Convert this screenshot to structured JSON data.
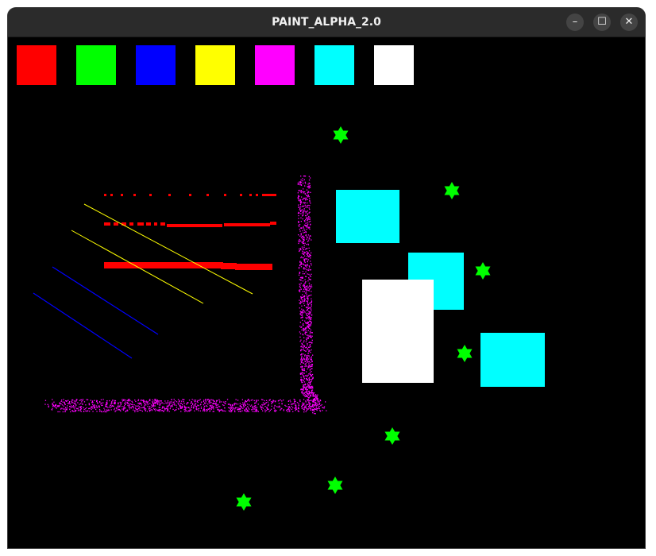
{
  "window": {
    "title": "PAINT_ALPHA_2.0",
    "controls": {
      "minimize": "–",
      "maximize": "☐",
      "close": "✕"
    }
  },
  "palette": [
    {
      "name": "red",
      "color": "#ff0000"
    },
    {
      "name": "green",
      "color": "#00ff00"
    },
    {
      "name": "blue",
      "color": "#0000ff"
    },
    {
      "name": "yellow",
      "color": "#ffff00"
    },
    {
      "name": "magenta",
      "color": "#ff00ff"
    },
    {
      "name": "cyan",
      "color": "#00ffff"
    },
    {
      "name": "white",
      "color": "#ffffff"
    }
  ],
  "canvas_background": "#000000",
  "stamp_icon": "hexagram-star"
}
